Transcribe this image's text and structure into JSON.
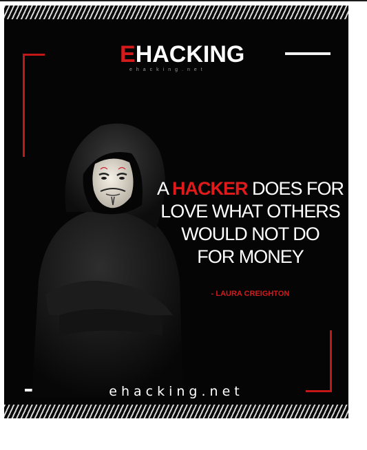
{
  "logo": {
    "prefix": "E",
    "word": "HACKING",
    "subtext": "ehacking.net"
  },
  "quote": {
    "line1_a": "A ",
    "line1_highlight": "HACKER",
    "line1_b": " DOES FOR",
    "line2": "LOVE WHAT OTHERS",
    "line3": "WOULD NOT DO",
    "line4": "FOR MONEY"
  },
  "author": "- LAURA CREIGHTON",
  "domain": "ehacking.net",
  "colors": {
    "accent": "#d41a1a",
    "background": "#050505",
    "text": "#ffffff"
  },
  "icons": {
    "figure": "hooded-masked-person-icon"
  }
}
